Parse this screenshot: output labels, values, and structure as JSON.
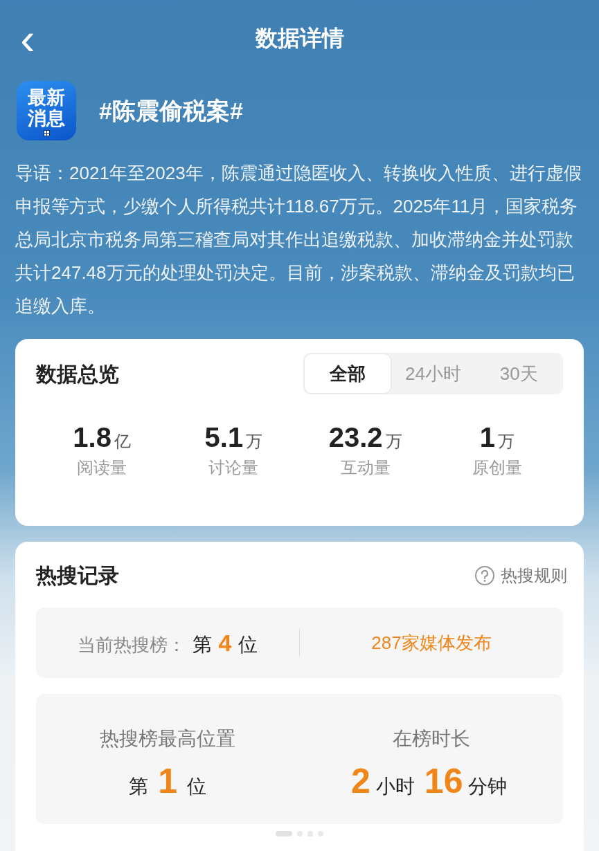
{
  "header": {
    "back": "‹",
    "title": "数据详情"
  },
  "topic": {
    "logo_lines": [
      "最新",
      "消息"
    ],
    "title": "#陈震偷税案#"
  },
  "intro": "导语：2021年至2023年，陈震通过隐匿收入、转换收入性质、进行虚假申报等方式，少缴个人所得税共计118.67万元。2025年11月，国家税务总局北京市税务局第三稽查局对其作出追缴税款、加收滞纳金并处罚款共计247.48万元的处理处罚决定。目前，涉案税款、滞纳金及罚款均已追缴入库。",
  "overview": {
    "title": "数据总览",
    "tabs": [
      {
        "label": "全部",
        "selected": true
      },
      {
        "label": "24小时",
        "selected": false
      },
      {
        "label": "30天",
        "selected": false
      }
    ],
    "stats": [
      {
        "value": "1.8",
        "unit": "亿",
        "label": "阅读量"
      },
      {
        "value": "5.1",
        "unit": "万",
        "label": "讨论量"
      },
      {
        "value": "23.2",
        "unit": "万",
        "label": "互动量"
      },
      {
        "value": "1",
        "unit": "万",
        "label": "原创量"
      }
    ]
  },
  "hot_search": {
    "title": "热搜记录",
    "rules_link": "热搜规则",
    "current_rank": {
      "label": "当前热搜榜：",
      "prefix": "第",
      "value": "4",
      "suffix": "位"
    },
    "media": "287家媒体发布",
    "peak": {
      "label": "热搜榜最高位置",
      "prefix": "第",
      "value": "1",
      "suffix": "位"
    },
    "duration": {
      "label": "在榜时长",
      "parts": [
        {
          "value": "2",
          "unit": "小时"
        },
        {
          "value": "16",
          "unit": "分钟"
        }
      ]
    }
  },
  "pager": [
    {
      "selected": true
    },
    {
      "selected": false
    },
    {
      "selected": false
    },
    {
      "selected": false
    }
  ]
}
